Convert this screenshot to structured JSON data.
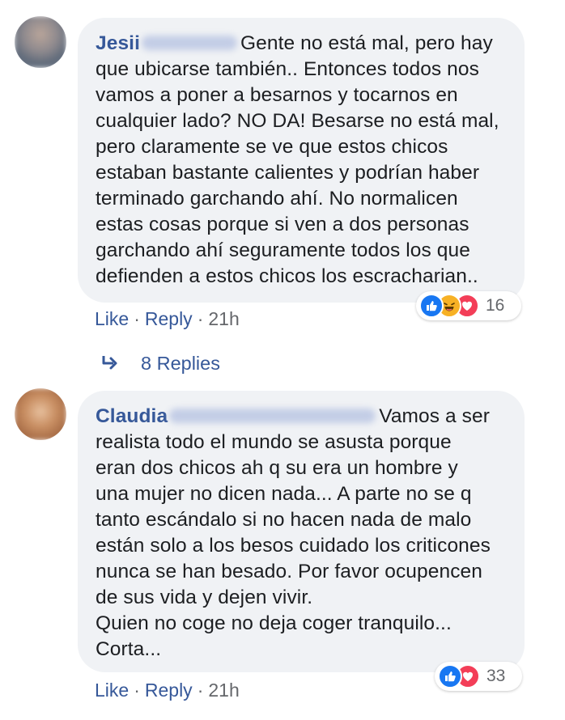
{
  "comments": [
    {
      "author": "Jesii",
      "text": "Gente no está mal, pero hay\nque ubicarse también.. Entonces todos nos\nvamos a poner a besarnos y tocarnos en\ncualquier lado? NO DA! Besarse no está mal,\npero claramente se ve que estos chicos\nestaban bastante calientes y podrían haber\nterminado garchando ahí. No normalicen\nestas cosas porque si ven a dos personas\ngarchando ahí seguramente todos los que\ndefienden a estos chicos los escracharian..",
      "reactions": [
        "like-icon",
        "haha-icon",
        "love-icon"
      ],
      "reaction_count": "16",
      "like_label": "Like",
      "reply_label": "Reply",
      "separator": "·",
      "time": "21h"
    },
    {
      "author": "Claudia",
      "text": "Vamos a ser\nrealista todo el mundo se asusta porque\neran dos chicos ah q su era un hombre y\nuna mujer no dicen nada... A parte no se q\ntanto escándalo si no hacen nada de malo\nestán solo a los besos cuidado los criticones\nnunca se han besado. Por favor ocupencen\nde sus vida y dejen vivir.\nQuien no coge no deja coger tranquilo...\nCorta...",
      "reactions": [
        "like-icon",
        "love-icon"
      ],
      "reaction_count": "33",
      "like_label": "Like",
      "reply_label": "Reply",
      "separator": "·",
      "time": "21h"
    }
  ],
  "replies_link": {
    "label": "8 Replies",
    "icon": "reply-arrow-icon"
  },
  "colors": {
    "link": "#365899",
    "bubble": "#f0f2f5",
    "meta": "#65676b",
    "like": "#1877f2",
    "love": "#f33e58",
    "haha": "#f7b125"
  }
}
